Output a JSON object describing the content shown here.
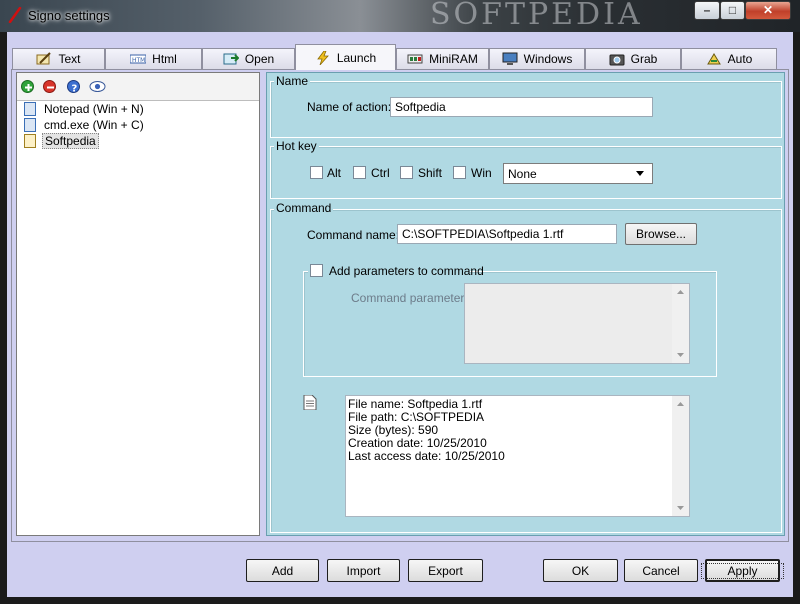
{
  "window": {
    "title": "Signo settings",
    "watermark": "SOFTPEDIA"
  },
  "tabs": [
    {
      "label": "Text",
      "icon": "pencil-icon"
    },
    {
      "label": "Html",
      "icon": "html-icon"
    },
    {
      "label": "Open",
      "icon": "open-icon"
    },
    {
      "label": "Launch",
      "icon": "lightning-icon"
    },
    {
      "label": "MiniRAM",
      "icon": "ram-icon"
    },
    {
      "label": "Windows",
      "icon": "monitor-icon"
    },
    {
      "label": "Grab",
      "icon": "camera-icon"
    },
    {
      "label": "Auto",
      "icon": "auto-icon"
    }
  ],
  "list": {
    "items": [
      {
        "label": "Notepad (Win + N)"
      },
      {
        "label": "cmd.exe (Win + C)"
      },
      {
        "label": "Softpedia",
        "selected": true
      }
    ]
  },
  "name_group": {
    "title": "Name",
    "label": "Name of action:",
    "value": "Softpedia"
  },
  "hotkey_group": {
    "title": "Hot key",
    "alt": "Alt",
    "ctrl": "Ctrl",
    "shift": "Shift",
    "win": "Win",
    "key": "None"
  },
  "command_group": {
    "title": "Command",
    "name_label": "Command name:",
    "name_value": "C:\\SOFTPEDIA\\Softpedia 1.rtf",
    "browse": "Browse...",
    "params_check": "Add parameters to command",
    "params_label": "Command parameters:",
    "info": [
      "File name: Softpedia 1.rtf",
      "File path: C:\\SOFTPEDIA",
      "Size (bytes): 590",
      "Creation date: 10/25/2010",
      "Last access date: 10/25/2010"
    ]
  },
  "buttons": {
    "add": "Add",
    "import": "Import",
    "export": "Export",
    "ok": "OK",
    "cancel": "Cancel",
    "apply": "Apply"
  },
  "colors": {
    "right_panel": "#b0d9e3",
    "frame": "#cfcff0",
    "close": "#c0402a"
  }
}
